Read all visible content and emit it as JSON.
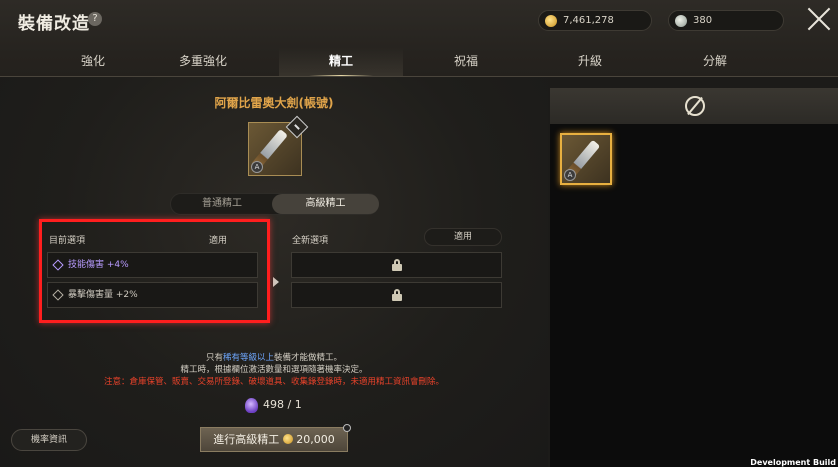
{
  "header": {
    "title": "裝備改造",
    "help_icon": "question-icon",
    "gold": "7,461,278",
    "feather": "380"
  },
  "tabs": [
    {
      "label": "強化"
    },
    {
      "label": "多重強化"
    },
    {
      "label": "精工"
    },
    {
      "label": "祝福"
    },
    {
      "label": "升級"
    },
    {
      "label": "分解"
    }
  ],
  "item": {
    "name": "阿爾比雷奧大劍(帳號)",
    "grade": "A"
  },
  "refine_mode": {
    "normal": "普通精工",
    "advanced": "高級精工",
    "selected": "advanced"
  },
  "current_options": {
    "header": "目前選項",
    "apply": "適用",
    "rows": [
      {
        "text": "技能傷害 +4%",
        "color": "purple"
      },
      {
        "text": "暴擊傷害量 +2%",
        "color": "white"
      }
    ]
  },
  "new_options": {
    "header": "全新選項",
    "apply_button": "適用"
  },
  "notes": {
    "line1_a": "只有",
    "line1_hi": "稀有等級以上",
    "line1_b": "裝備才能做精工。",
    "line2": "精工時，根據欄位激活數量和選項隨著機率決定。",
    "line3": "注意：倉庫保管、販賣、交易所登錄、破壞道具、收集錄登錄時，未適用精工資訊會刪除。"
  },
  "cost": {
    "value": "498 / 1"
  },
  "buttons": {
    "probability": "機率資訊",
    "refine": "進行高級精工",
    "refine_cost": "20,000"
  },
  "footer": {
    "dev": "Development Build"
  },
  "colors": {
    "item_name": "#e0a44a",
    "highlight_box": "#ff1e1e",
    "warning_text": "#e8422a",
    "purple_option": "#b89bff",
    "rare_text": "#6fa8ff"
  }
}
